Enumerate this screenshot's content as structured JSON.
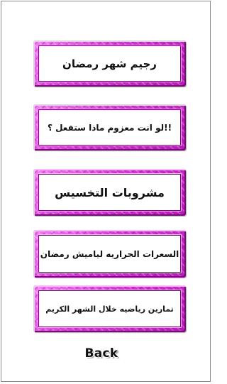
{
  "menu": {
    "items": [
      {
        "label": "رجيم شهر رمضان"
      },
      {
        "label": "!!لو انت معزوم ماذا ستفعل ؟"
      },
      {
        "label": "مشروبات التخسيس"
      },
      {
        "label": "السعرات الحراريه لياميش رمضان"
      },
      {
        "label": "تمارين رياضيه خلال الشهر الكريم"
      }
    ]
  },
  "navigation": {
    "back_label": "Back"
  }
}
